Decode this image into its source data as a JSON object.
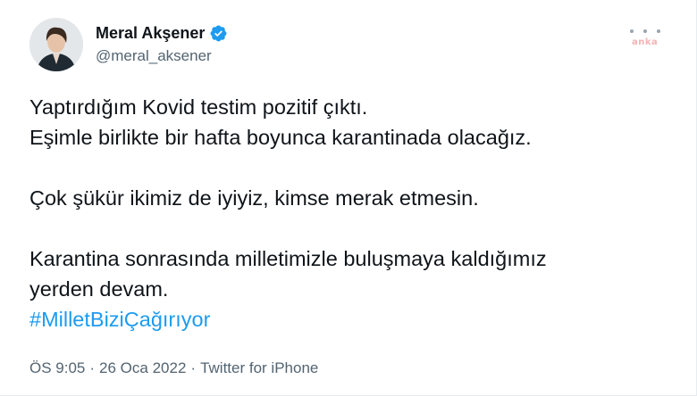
{
  "author": {
    "name": "Meral Akşener",
    "handle": "@meral_aksener",
    "verified": true
  },
  "watermark": "anka",
  "tweet": {
    "line1": "Yaptırdığım Kovid testim pozitif çıktı.",
    "line2": "Eşimle birlikte bir hafta boyunca karantinada olacağız.",
    "line3": "Çok şükür ikimiz de iyiyiz, kimse merak etmesin.",
    "line4": "Karantina sonrasında milletimizle buluşmaya kaldığımız",
    "line5": "yerden devam.",
    "hashtag": "#MilletBiziÇağırıyor"
  },
  "meta": {
    "time": "ÖS 9:05",
    "separator": "·",
    "date": "26 Oca 2022",
    "source": "Twitter for iPhone"
  },
  "colors": {
    "text": "#0f1419",
    "secondary": "#536471",
    "link": "#1d9bf0",
    "verified": "#1d9bf0"
  },
  "icons": {
    "verified": "verified-badge-icon",
    "more": "more-options-icon"
  }
}
